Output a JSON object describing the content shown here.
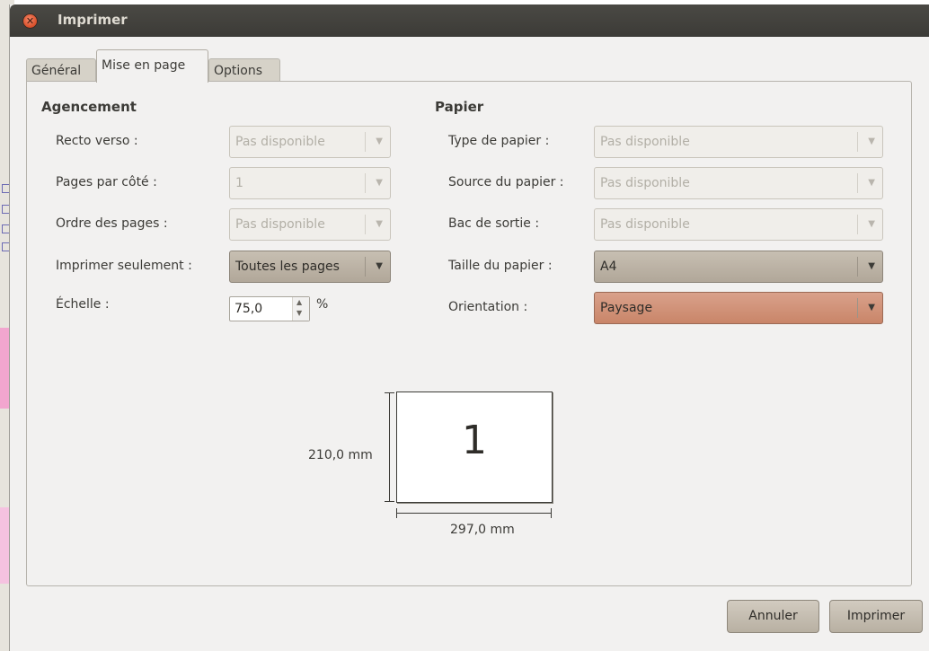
{
  "window": {
    "title": "Imprimer"
  },
  "tabs": [
    {
      "label": "Général"
    },
    {
      "label": "Mise en page"
    },
    {
      "label": "Options"
    }
  ],
  "layout_section": {
    "title": "Agencement",
    "rows": [
      {
        "label": "Recto verso :",
        "value": "Pas disponible"
      },
      {
        "label": "Pages par côté :",
        "value": "1"
      },
      {
        "label": "Ordre des pages :",
        "value": "Pas disponible"
      },
      {
        "label": "Imprimer seulement :",
        "value": "Toutes les pages"
      }
    ],
    "scale": {
      "label": "Échelle :",
      "value": "75,0",
      "unit": "%"
    }
  },
  "paper_section": {
    "title": "Papier",
    "rows": [
      {
        "label": "Type de papier :",
        "value": "Pas disponible"
      },
      {
        "label": "Source du papier :",
        "value": "Pas disponible"
      },
      {
        "label": "Bac de sortie :",
        "value": "Pas disponible"
      },
      {
        "label": "Taille du papier :",
        "value": "A4"
      },
      {
        "label": "Orientation :",
        "value": "Paysage"
      }
    ]
  },
  "preview": {
    "page_number": "1",
    "height_label": "210,0 mm",
    "width_label": "297,0 mm"
  },
  "buttons": {
    "cancel": "Annuler",
    "print": "Imprimer"
  },
  "icons": {
    "close": "close-icon",
    "dropdown": "dropdown-arrow-icon",
    "spin_up": "spin-up-icon",
    "spin_down": "spin-down-icon"
  }
}
